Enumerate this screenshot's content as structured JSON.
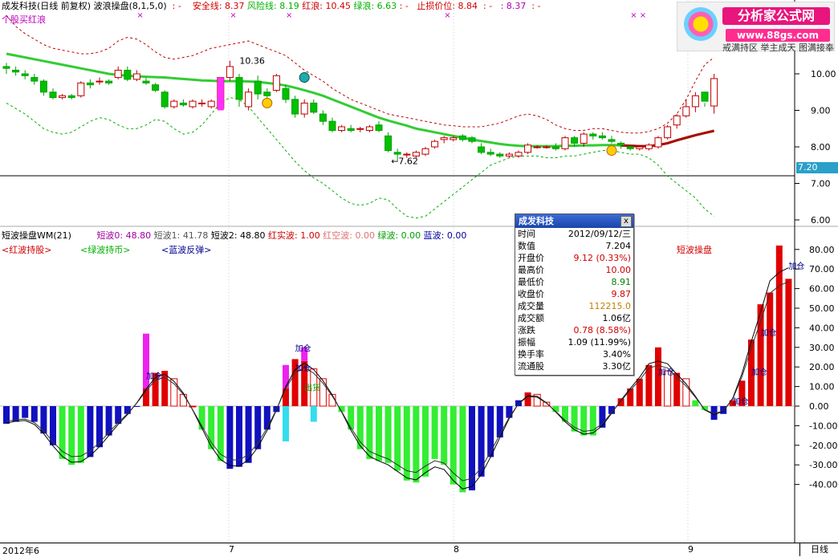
{
  "header_top": {
    "title": "成发科技(日线 前复权)",
    "indicator": "波浪操盘(8,1,5,0)",
    "safe_line": "安全线: 8.37",
    "risk_line": "风险线: 8.19",
    "red_wave": "红浪: 10.45",
    "green_wave": "绿浪: 6.63",
    "stop_loss": "止损价位: 8.84",
    "extra": ": 8.37",
    "signal_label": "个股买红浪"
  },
  "header_bottom": {
    "title": "短波操盘WM(21)",
    "sw0": "短波0: 48.80",
    "sw1": "短波1: 41.78",
    "sw2": "短波2: 48.80",
    "red_real": "红实波: 1.00",
    "red_empty": "红空波: 0.00",
    "green": "绿波: 0.00",
    "blue": "蓝波: 0.00",
    "legend_red": "<红波持股>",
    "legend_green": "<绿波持币>",
    "legend_blue": "<蓝波反弹>",
    "panel_label": "短波操盘"
  },
  "logo": {
    "brand": "分析家公式网",
    "url": "www.88gs.com",
    "sub": "戒满持区 举主成天 图满接奉"
  },
  "popup": {
    "title": "成发科技",
    "close": "x",
    "rows": [
      {
        "k": "时间",
        "v": "2012/09/12/三",
        "c": "#000000"
      },
      {
        "k": "数值",
        "v": "7.204",
        "c": "#000000"
      },
      {
        "k": "开盘价",
        "v": "9.12 (0.33%)",
        "c": "#d00000"
      },
      {
        "k": "最高价",
        "v": "10.00",
        "c": "#d00000"
      },
      {
        "k": "最低价",
        "v": "8.91",
        "c": "#008000"
      },
      {
        "k": "收盘价",
        "v": "9.87",
        "c": "#d00000"
      },
      {
        "k": "成交量",
        "v": "112215.0",
        "c": "#c08000"
      },
      {
        "k": "成交额",
        "v": "1.06亿",
        "c": "#000000"
      },
      {
        "k": "涨跌",
        "v": "0.78 (8.58%)",
        "c": "#d00000"
      },
      {
        "k": "振幅",
        "v": "1.09 (11.99%)",
        "c": "#000000"
      },
      {
        "k": "换手率",
        "v": "3.40%",
        "c": "#000000"
      },
      {
        "k": "流通股",
        "v": "3.30亿",
        "c": "#000000"
      }
    ]
  },
  "current_value": "7.20",
  "period_label": "日线",
  "x_labels": [
    "2012年6",
    "7",
    "8",
    "9"
  ],
  "chart_data": [
    {
      "type": "candlestick",
      "ylim": [
        5.8,
        11.0
      ],
      "y_ticks": [
        "10.00",
        "9.00",
        "8.00",
        "7.00",
        "6.00"
      ],
      "annotations": [
        "10.36",
        "←7.62"
      ],
      "candles": [
        [
          10.2,
          10.3,
          10.0,
          10.15
        ],
        [
          10.1,
          10.2,
          9.95,
          10.05
        ],
        [
          10.0,
          10.1,
          9.85,
          9.95
        ],
        [
          9.9,
          10.0,
          9.7,
          9.8
        ],
        [
          9.8,
          9.85,
          9.4,
          9.5
        ],
        [
          9.5,
          9.6,
          9.3,
          9.35
        ],
        [
          9.35,
          9.45,
          9.3,
          9.4
        ],
        [
          9.4,
          9.45,
          9.3,
          9.35
        ],
        [
          9.4,
          9.8,
          9.35,
          9.75
        ],
        [
          9.75,
          9.85,
          9.6,
          9.7
        ],
        [
          9.8,
          9.9,
          9.7,
          9.8
        ],
        [
          9.8,
          9.85,
          9.7,
          9.75
        ],
        [
          9.9,
          10.2,
          9.85,
          10.1
        ],
        [
          10.1,
          10.2,
          9.8,
          9.85
        ],
        [
          9.85,
          10.1,
          9.8,
          10.0
        ],
        [
          9.8,
          9.9,
          9.7,
          9.75
        ],
        [
          9.7,
          9.75,
          9.5,
          9.55
        ],
        [
          9.5,
          9.55,
          9.05,
          9.1
        ],
        [
          9.1,
          9.3,
          9.05,
          9.25
        ],
        [
          9.2,
          9.3,
          9.1,
          9.15
        ],
        [
          9.1,
          9.3,
          9.05,
          9.25
        ],
        [
          9.2,
          9.3,
          9.1,
          9.2
        ],
        [
          9.1,
          9.3,
          9.05,
          9.25
        ],
        [
          9.05,
          9.9,
          9.0,
          9.9
        ],
        [
          9.9,
          10.36,
          9.8,
          10.2
        ],
        [
          9.9,
          10.0,
          9.1,
          9.3
        ],
        [
          9.1,
          9.6,
          9.0,
          9.5
        ],
        [
          9.8,
          9.95,
          9.3,
          9.45
        ],
        [
          9.5,
          9.6,
          9.3,
          9.4
        ],
        [
          9.55,
          10.0,
          9.5,
          9.95
        ],
        [
          9.6,
          9.7,
          9.2,
          9.3
        ],
        [
          9.3,
          9.4,
          8.8,
          8.9
        ],
        [
          8.9,
          9.3,
          8.8,
          9.2
        ],
        [
          9.2,
          9.3,
          8.9,
          8.95
        ],
        [
          8.9,
          9.0,
          8.6,
          8.7
        ],
        [
          8.7,
          8.8,
          8.4,
          8.45
        ],
        [
          8.45,
          8.6,
          8.4,
          8.55
        ],
        [
          8.5,
          8.6,
          8.4,
          8.45
        ],
        [
          8.5,
          8.55,
          8.4,
          8.5
        ],
        [
          8.45,
          8.6,
          8.4,
          8.55
        ],
        [
          8.6,
          8.7,
          8.4,
          8.45
        ],
        [
          8.3,
          8.4,
          7.85,
          7.9
        ],
        [
          7.85,
          7.95,
          7.62,
          7.8
        ],
        [
          7.8,
          7.85,
          7.7,
          7.8
        ],
        [
          7.75,
          7.9,
          7.7,
          7.85
        ],
        [
          7.8,
          8.0,
          7.75,
          7.95
        ],
        [
          8.0,
          8.2,
          7.95,
          8.15
        ],
        [
          8.2,
          8.3,
          8.1,
          8.25
        ],
        [
          8.2,
          8.3,
          8.15,
          8.25
        ],
        [
          8.3,
          8.35,
          8.15,
          8.2
        ],
        [
          8.25,
          8.3,
          8.1,
          8.15
        ],
        [
          8.0,
          8.1,
          7.8,
          7.85
        ],
        [
          7.85,
          7.95,
          7.75,
          7.8
        ],
        [
          7.8,
          7.85,
          7.7,
          7.75
        ],
        [
          7.75,
          7.85,
          7.7,
          7.8
        ],
        [
          7.75,
          7.9,
          7.7,
          7.85
        ],
        [
          7.85,
          8.1,
          7.8,
          8.05
        ],
        [
          8.0,
          8.05,
          7.95,
          8.0
        ],
        [
          8.0,
          8.05,
          7.95,
          8.0
        ],
        [
          8.0,
          8.1,
          7.9,
          7.95
        ],
        [
          7.95,
          8.3,
          7.9,
          8.25
        ],
        [
          8.25,
          8.3,
          8.0,
          8.1
        ],
        [
          8.1,
          8.4,
          8.0,
          8.35
        ],
        [
          8.35,
          8.4,
          8.2,
          8.3
        ],
        [
          8.3,
          8.4,
          8.2,
          8.25
        ],
        [
          8.2,
          8.3,
          8.1,
          8.15
        ],
        [
          8.1,
          8.15,
          7.95,
          8.05
        ],
        [
          8.0,
          8.05,
          7.9,
          7.95
        ],
        [
          7.95,
          8.0,
          7.9,
          8.0
        ],
        [
          7.95,
          8.1,
          7.9,
          8.05
        ],
        [
          8.0,
          8.3,
          7.95,
          8.25
        ],
        [
          8.25,
          8.6,
          8.2,
          8.55
        ],
        [
          8.6,
          8.9,
          8.5,
          8.85
        ],
        [
          8.85,
          9.3,
          8.8,
          9.1
        ],
        [
          9.1,
          9.5,
          8.95,
          9.4
        ],
        [
          9.5,
          9.2,
          9.1,
          9.25
        ],
        [
          9.12,
          10.0,
          8.91,
          9.87
        ]
      ],
      "ma_green": [
        10.55,
        10.5,
        10.45,
        10.4,
        10.35,
        10.3,
        10.25,
        10.2,
        10.15,
        10.1,
        10.05,
        10.0,
        9.97,
        9.95,
        9.93,
        9.92,
        9.91,
        9.9,
        9.88,
        9.86,
        9.84,
        9.82,
        9.81,
        9.8,
        9.8,
        9.8,
        9.79,
        9.78,
        9.75,
        9.72,
        9.68,
        9.62,
        9.55,
        9.48,
        9.4,
        9.3,
        9.2,
        9.1,
        9.0,
        8.9,
        8.8,
        8.72,
        8.65,
        8.58,
        8.5,
        8.45,
        8.4,
        8.35,
        8.3,
        8.25,
        8.2,
        8.16,
        8.12,
        8.08,
        8.05,
        8.03,
        8.02,
        8.02,
        8.02,
        8.02,
        8.03,
        8.03,
        8.04,
        8.04,
        8.05,
        8.05,
        8.04,
        8.03,
        8.02,
        8.02,
        8.05,
        8.1,
        8.18,
        8.25,
        8.32,
        8.38,
        8.44
      ],
      "upper_band": [
        11.6,
        11.3,
        11.1,
        10.95,
        10.8,
        10.7,
        10.65,
        10.6,
        10.55,
        10.55,
        10.6,
        10.7,
        10.9,
        11.0,
        10.95,
        10.8,
        10.6,
        10.45,
        10.4,
        10.45,
        10.5,
        10.6,
        10.7,
        10.75,
        10.8,
        10.85,
        10.9,
        10.8,
        10.7,
        10.6,
        10.5,
        10.3,
        10.1,
        9.95,
        9.8,
        9.6,
        9.45,
        9.3,
        9.2,
        9.1,
        9.0,
        8.9,
        8.85,
        8.8,
        8.75,
        8.7,
        8.65,
        8.6,
        8.58,
        8.55,
        8.55,
        8.55,
        8.6,
        8.65,
        8.75,
        8.85,
        8.9,
        8.85,
        8.75,
        8.6,
        8.5,
        8.45,
        8.45,
        8.5,
        8.5,
        8.45,
        8.4,
        8.38,
        8.38,
        8.42,
        8.5,
        8.65,
        8.9,
        9.3,
        9.8,
        10.25,
        10.45
      ],
      "lower_band": [
        9.2,
        9.05,
        8.9,
        8.7,
        8.5,
        8.4,
        8.35,
        8.4,
        8.55,
        8.7,
        8.8,
        8.75,
        8.6,
        8.5,
        8.5,
        8.6,
        8.75,
        8.7,
        8.5,
        8.35,
        8.4,
        8.6,
        8.9,
        9.2,
        9.35,
        9.3,
        9.1,
        8.8,
        8.5,
        8.2,
        7.9,
        7.6,
        7.35,
        7.15,
        7.0,
        6.8,
        6.6,
        6.45,
        6.4,
        6.45,
        6.6,
        6.55,
        6.3,
        6.1,
        6.05,
        6.1,
        6.3,
        6.5,
        6.7,
        6.9,
        7.1,
        7.3,
        7.5,
        7.6,
        7.7,
        7.75,
        7.75,
        7.75,
        7.7,
        7.7,
        7.75,
        7.75,
        7.8,
        7.85,
        7.9,
        7.9,
        7.85,
        7.8,
        7.8,
        7.7,
        7.5,
        7.2,
        7.0,
        6.8,
        6.6,
        6.3,
        6.1
      ]
    },
    {
      "type": "bar",
      "ylim": [
        -47,
        85
      ],
      "y_ticks": [
        "80.00",
        "70.00",
        "60.00",
        "50.00",
        "40.00",
        "30.00",
        "20.00",
        "10.00",
        "0.00",
        "-10.00",
        "-20.00",
        "-30.00",
        "-40.00"
      ],
      "legend": [
        "红波持股",
        "绿波持币",
        "蓝波反弹"
      ],
      "signals": [
        "加仓",
        "加仓",
        "出货",
        "加仓",
        "加仓",
        "加仓",
        "加仓",
        "加仓",
        "加仓"
      ],
      "values": [
        -9,
        -8,
        -6,
        -8,
        -14,
        -20,
        -27,
        -30,
        -29,
        -26,
        -21,
        -15,
        -9,
        -4,
        0,
        9,
        17,
        18,
        14,
        6,
        0,
        -12,
        -22,
        -28,
        -32,
        -31,
        -29,
        -22,
        -12,
        -3,
        9,
        24,
        23,
        19,
        14,
        6,
        -3,
        -12,
        -22,
        -27,
        -28,
        -29,
        -33,
        -38,
        -39,
        -36,
        -27,
        -30,
        -40,
        -44,
        -43,
        -36,
        -26,
        -16,
        -6,
        3,
        7,
        6,
        2,
        -3,
        -8,
        -13,
        -15,
        -15,
        -11,
        -4,
        4,
        9,
        14,
        21,
        30,
        18,
        17,
        14,
        3,
        -2,
        -7,
        -4,
        3,
        13,
        34,
        52,
        58,
        82,
        65
      ],
      "colors": [
        "b",
        "b",
        "b",
        "b",
        "b",
        "b",
        "g",
        "g",
        "g",
        "b",
        "b",
        "b",
        "b",
        "b",
        "b",
        "r",
        "r",
        "r",
        "h",
        "h",
        "h",
        "g",
        "g",
        "g",
        "b",
        "b",
        "b",
        "b",
        "b",
        "b",
        "r",
        "r",
        "r",
        "h",
        "h",
        "h",
        "g",
        "g",
        "g",
        "g",
        "g",
        "g",
        "g",
        "g",
        "g",
        "g",
        "g",
        "g",
        "g",
        "g",
        "b",
        "b",
        "b",
        "b",
        "b",
        "b",
        "r",
        "h",
        "h",
        "g",
        "g",
        "g",
        "g",
        "g",
        "b",
        "b",
        "r",
        "r",
        "r",
        "r",
        "r",
        "h",
        "r",
        "h",
        "g",
        "g",
        "b",
        "b",
        "r",
        "r",
        "r",
        "r",
        "r",
        "r",
        "r"
      ],
      "magenta_tops": [
        37,
        21,
        30,
        12,
        12,
        27,
        27,
        17,
        32
      ],
      "cyan_dips": [
        -18,
        -8
      ]
    }
  ]
}
